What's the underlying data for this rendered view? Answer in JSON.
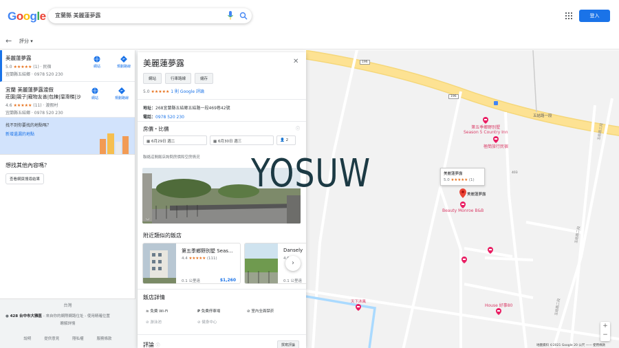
{
  "header": {
    "logo_letters": [
      "G",
      "o",
      "o",
      "g",
      "l",
      "e"
    ],
    "logo_colors": [
      "#4285f4",
      "#ea4335",
      "#fbbc05",
      "#4285f4",
      "#34a853",
      "#ea4335"
    ],
    "search_query": "宜蘭縣 美麗蓮夢露",
    "login_label": "登入"
  },
  "subbar": {
    "back_icon": "←",
    "sort_label": "評分 ▾"
  },
  "results": [
    {
      "name": "美麗蓮夢露",
      "rating": "5.0",
      "stars": "★★★★★",
      "reviews": "(1)",
      "type": "民宿",
      "address": "宜蘭縣五結鄉",
      "phone": "0978 520 230",
      "website_label": "網站",
      "directions_label": "規劃路線"
    },
    {
      "name": "宜蘭 美麗蓮夢露渡假",
      "name2": "莊園|親子|寵物友善|包棟|溜滑梯|沙",
      "rating": "4.6",
      "stars": "★★★★★",
      "reviews": "(11)",
      "type": "渡假村",
      "address": "宜蘭縣五結鄉",
      "phone": "0978 520 230",
      "website_label": "網站",
      "directions_label": "規劃路線"
    }
  ],
  "promo": {
    "text": "找不到你要找的地點嗎？",
    "link": "新增遺漏的地點"
  },
  "other": {
    "title": "想找其他內容嗎？",
    "button": "查看網頁搜尋結果"
  },
  "footer": {
    "country": "台灣",
    "location": "428 台中市大雅區",
    "location_note": " - 來自你的網際網路位址 - 使用精確位置",
    "learn_more": "瞭解詳情",
    "links": [
      "說明",
      "提供意見",
      "隱私權",
      "服務條款"
    ]
  },
  "panel": {
    "title": "美麗蓮夢露",
    "close_icon": "✕",
    "buttons": [
      "網站",
      "行車路線",
      "儲存"
    ],
    "rating": "5.0",
    "stars": "★★★★★",
    "reviews_link": "1 則 Google 評論",
    "address_label": "地址：",
    "address_value": "268宜蘭縣五結鄉五結路一段469巷42號",
    "phone_label": "電話：",
    "phone_value": "0978 520 230",
    "price_heading": "房價・比價",
    "checkin": "6月29日 週二",
    "checkout": "6月30日 週三",
    "guests": "2",
    "price_note": "聯絡這間飯店詢問房價和空房情況",
    "similar_heading": "附近類似的飯店",
    "cards": [
      {
        "name": "第五季鄉野別墅 Seas...",
        "rating": "4.4",
        "stars": "★★★★★",
        "reviews": "(111)",
        "distance": "0.1 公里遠",
        "price": "$1,260"
      },
      {
        "name": "Dansely",
        "rating": "4.6",
        "stars": "★★★★★",
        "reviews": "",
        "distance": "0.1 公里遠",
        "price": ""
      }
    ],
    "next_icon": "›",
    "details_heading": "飯店詳情",
    "amenities": [
      {
        "label": "免費 Wi-Fi",
        "icon": "wifi-icon",
        "available": true
      },
      {
        "label": "免費停車場",
        "icon": "parking-icon",
        "available": true
      },
      {
        "label": "室內全面禁菸",
        "icon": "no-smoking-icon",
        "available": true
      },
      {
        "label": "游泳池",
        "icon": "pool-icon",
        "available": false
      },
      {
        "label": "健身中心",
        "icon": "gym-icon",
        "available": false
      }
    ],
    "review_heading": "評論",
    "write_review": "撰寫評論"
  },
  "watermark": "YOSUW",
  "map": {
    "road_labels": [
      "196",
      "196",
      "五結路一段",
      "403",
      "五結路三段",
      "五結路二段",
      "五結路二段"
    ],
    "pois": [
      {
        "name": "第五季鄉野別墅",
        "name2": "Season 5 Country Inn",
        "color": "#d93b66"
      },
      {
        "name": "極簡旅行民宿",
        "color": "#d93b66"
      },
      {
        "name": "美麗蓮夢露",
        "color": "#202124"
      },
      {
        "name": "Beauty Monroe B&B",
        "color": "#d93b66"
      },
      {
        "name": "天下沐風",
        "color": "#d93b66"
      },
      {
        "name": "House 好事80",
        "color": "#d93b66"
      }
    ],
    "tooltip_name": "美麗蓮夢露",
    "tooltip_rating": "5.0",
    "tooltip_stars": "★★★★★",
    "tooltip_reviews": "(1)",
    "zoom_in": "+",
    "zoom_out": "−",
    "footer": "地圖資料 ©2021 Google   20 公尺 ——   使用條款"
  },
  "colors": {
    "accent": "#1a73e8",
    "star": "#e7711b",
    "road_major": "#fde293",
    "poi": "#d93b66",
    "pin": "#ea4335",
    "water": "#aadaff"
  }
}
